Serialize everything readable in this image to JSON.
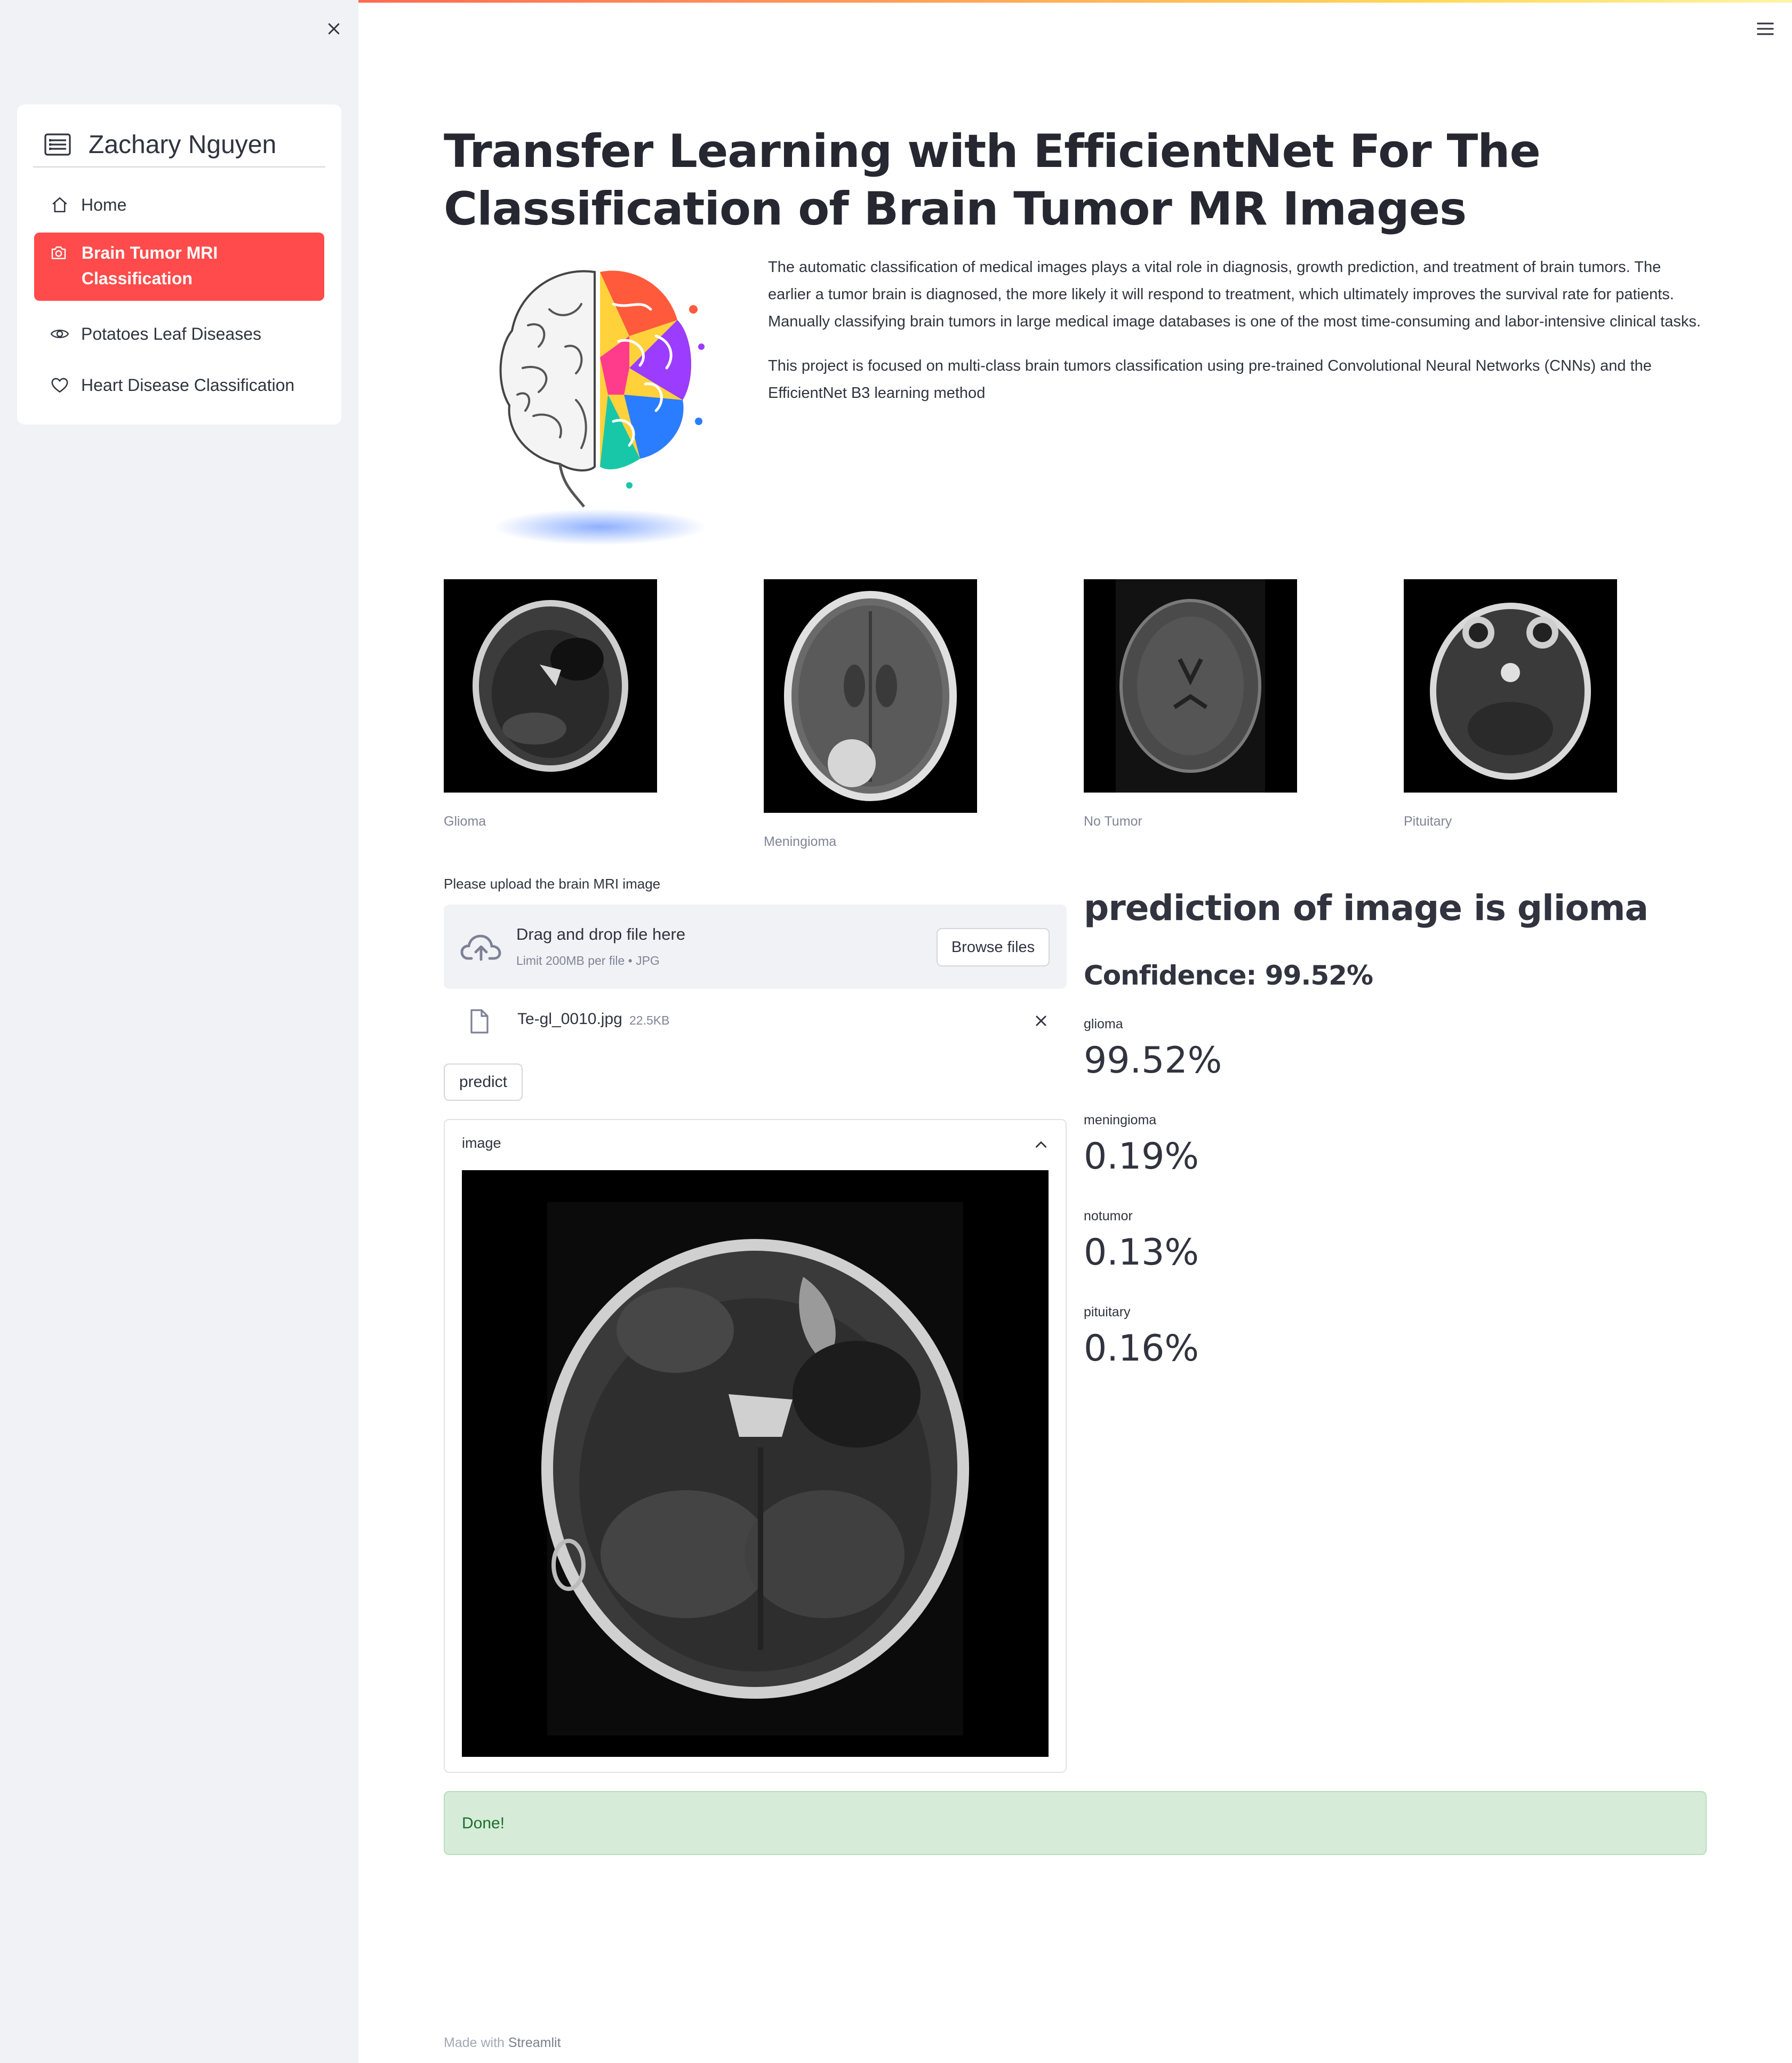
{
  "sidebar": {
    "title": "Zachary Nguyen",
    "items": [
      {
        "label": "Home",
        "icon": "house-icon"
      },
      {
        "label": "Brain Tumor MRI Classification",
        "icon": "camera-icon",
        "active": true
      },
      {
        "label": "Potatoes Leaf Diseases",
        "icon": "eye-icon"
      },
      {
        "label": "Heart Disease Classification",
        "icon": "heart-icon"
      }
    ],
    "accent_color": "#ff4b4b"
  },
  "main": {
    "title": "Transfer Learning with EfficientNet For The Classification of Brain Tumor MR Images",
    "intro_paragraph_1": "The automatic classification of medical images plays a vital role in diagnosis, growth prediction, and treatment of brain tumors. The earlier a tumor brain is diagnosed, the more likely it will respond to treatment, which ultimately improves the survival rate for patients. Manually classifying brain tumors in large medical image databases is one of the most time-consuming and labor-intensive clinical tasks.",
    "intro_paragraph_2": "This project is focused on multi-class brain tumors classification using pre-trained Convolutional Neural Networks (CNNs) and the EfficientNet B3 learning method",
    "samples": [
      {
        "caption": "Glioma"
      },
      {
        "caption": "Meningioma"
      },
      {
        "caption": "No Tumor"
      },
      {
        "caption": "Pituitary"
      }
    ]
  },
  "uploader": {
    "label": "Please upload the brain MRI image",
    "drag_text": "Drag and drop file here",
    "limit_text": "Limit 200MB per file • JPG",
    "browse_label": "Browse files",
    "file_name": "Te-gl_0010.jpg",
    "file_size": "22.5KB"
  },
  "predict_label": "predict",
  "expander_label": "image",
  "results": {
    "prediction_title": "prediction of image is glioma",
    "confidence": "Confidence: 99.52%",
    "metrics": [
      {
        "label": "glioma",
        "value": "99.52%"
      },
      {
        "label": "meningioma",
        "value": "0.19%"
      },
      {
        "label": "notumor",
        "value": "0.13%"
      },
      {
        "label": "pituitary",
        "value": "0.16%"
      }
    ]
  },
  "status": {
    "message": "Done!"
  },
  "footer": {
    "prefix": "Made with",
    "brand": "Streamlit"
  }
}
